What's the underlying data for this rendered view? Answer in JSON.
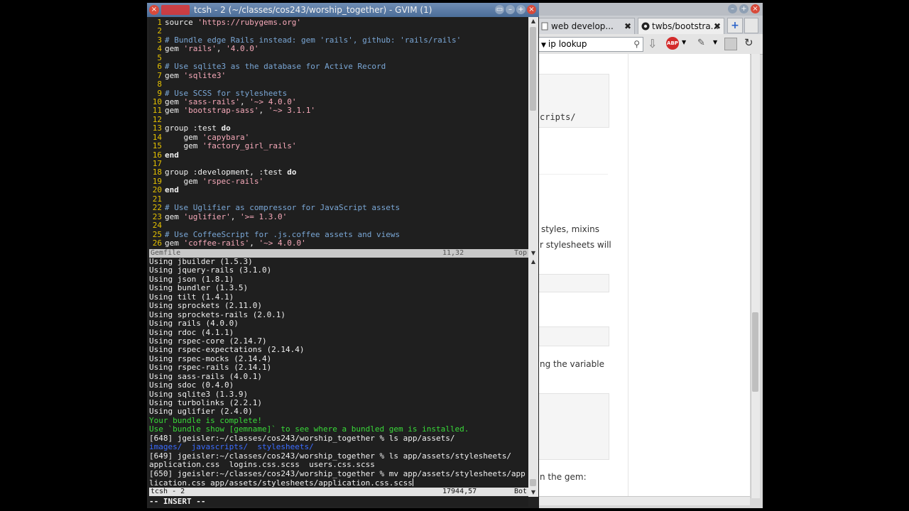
{
  "browser": {
    "tabs": [
      {
        "label": "web develop...",
        "close": "✖"
      },
      {
        "label": "twbs/bootstra...",
        "close": "✖"
      }
    ],
    "search": {
      "value": "ip lookup"
    },
    "page_fragments": [
      "cripts/",
      "styles, mixins",
      "r stylesheets will",
      "ng the variable",
      "n the gem:"
    ]
  },
  "gvim": {
    "title": "tcsh - 2 (~/classes/cos243/worship_together) - GVIM (1)",
    "editor_lines": [
      [
        {
          "t": "source ",
          "c": "tx"
        },
        {
          "t": "'https://rubygems.org'",
          "c": "str"
        }
      ],
      [],
      [
        {
          "t": "# Bundle edge Rails instead: gem 'rails', github: 'rails/rails'",
          "c": "cm"
        }
      ],
      [
        {
          "t": "gem ",
          "c": "tx"
        },
        {
          "t": "'rails'",
          "c": "str"
        },
        {
          "t": ", ",
          "c": "tx"
        },
        {
          "t": "'4.0.0'",
          "c": "str"
        }
      ],
      [],
      [
        {
          "t": "# Use sqlite3 as the database for Active Record",
          "c": "cm"
        }
      ],
      [
        {
          "t": "gem ",
          "c": "tx"
        },
        {
          "t": "'sqlite3'",
          "c": "str"
        }
      ],
      [],
      [
        {
          "t": "# Use SCSS for stylesheets",
          "c": "cm"
        }
      ],
      [
        {
          "t": "gem ",
          "c": "tx"
        },
        {
          "t": "'sass-rails'",
          "c": "str"
        },
        {
          "t": ", ",
          "c": "tx"
        },
        {
          "t": "'~> 4.0.0'",
          "c": "str"
        }
      ],
      [
        {
          "t": "gem ",
          "c": "tx"
        },
        {
          "t": "'bootstrap-sass'",
          "c": "str"
        },
        {
          "t": ", ",
          "c": "tx"
        },
        {
          "t": "'~> 3.1.1'",
          "c": "str"
        }
      ],
      [],
      [
        {
          "t": "group ",
          "c": "tx"
        },
        {
          "t": ":test ",
          "c": "sym"
        },
        {
          "t": "do",
          "c": "kw"
        }
      ],
      [
        {
          "t": "    gem ",
          "c": "tx"
        },
        {
          "t": "'capybara'",
          "c": "str"
        }
      ],
      [
        {
          "t": "    gem ",
          "c": "tx"
        },
        {
          "t": "'factory_girl_rails'",
          "c": "str"
        }
      ],
      [
        {
          "t": "end",
          "c": "kw"
        }
      ],
      [],
      [
        {
          "t": "group ",
          "c": "tx"
        },
        {
          "t": ":development",
          "c": "sym"
        },
        {
          "t": ", ",
          "c": "tx"
        },
        {
          "t": ":test ",
          "c": "sym"
        },
        {
          "t": "do",
          "c": "kw"
        }
      ],
      [
        {
          "t": "    gem ",
          "c": "tx"
        },
        {
          "t": "'rspec-rails'",
          "c": "str"
        }
      ],
      [
        {
          "t": "end",
          "c": "kw"
        }
      ],
      [],
      [
        {
          "t": "# Use Uglifier as compressor for JavaScript assets",
          "c": "cm"
        }
      ],
      [
        {
          "t": "gem ",
          "c": "tx"
        },
        {
          "t": "'uglifier'",
          "c": "str"
        },
        {
          "t": ", ",
          "c": "tx"
        },
        {
          "t": "'>= 1.3.0'",
          "c": "str"
        }
      ],
      [],
      [
        {
          "t": "# Use CoffeeScript for .js.coffee assets and views",
          "c": "cm"
        }
      ],
      [
        {
          "t": "gem ",
          "c": "tx"
        },
        {
          "t": "'coffee-rails'",
          "c": "str"
        },
        {
          "t": ", ",
          "c": "tx"
        },
        {
          "t": "'~> 4.0.0'",
          "c": "str"
        }
      ]
    ],
    "status_top": {
      "file": "Gemfile",
      "pos": "11,32",
      "scroll": "Top"
    },
    "terminal_lines": [
      [
        {
          "t": "Using jbuilder (1.5.3)",
          "c": "tw"
        }
      ],
      [
        {
          "t": "Using jquery-rails (3.1.0)",
          "c": "tw"
        }
      ],
      [
        {
          "t": "Using json (1.8.1)",
          "c": "tw"
        }
      ],
      [
        {
          "t": "Using bundler (1.3.5)",
          "c": "tw"
        }
      ],
      [
        {
          "t": "Using tilt (1.4.1)",
          "c": "tw"
        }
      ],
      [
        {
          "t": "Using sprockets (2.11.0)",
          "c": "tw"
        }
      ],
      [
        {
          "t": "Using sprockets-rails (2.0.1)",
          "c": "tw"
        }
      ],
      [
        {
          "t": "Using rails (4.0.0)",
          "c": "tw"
        }
      ],
      [
        {
          "t": "Using rdoc (4.1.1)",
          "c": "tw"
        }
      ],
      [
        {
          "t": "Using rspec-core (2.14.7)",
          "c": "tw"
        }
      ],
      [
        {
          "t": "Using rspec-expectations (2.14.4)",
          "c": "tw"
        }
      ],
      [
        {
          "t": "Using rspec-mocks (2.14.4)",
          "c": "tw"
        }
      ],
      [
        {
          "t": "Using rspec-rails (2.14.1)",
          "c": "tw"
        }
      ],
      [
        {
          "t": "Using sass-rails (4.0.1)",
          "c": "tw"
        }
      ],
      [
        {
          "t": "Using sdoc (0.4.0)",
          "c": "tw"
        }
      ],
      [
        {
          "t": "Using sqlite3 (1.3.9)",
          "c": "tw"
        }
      ],
      [
        {
          "t": "Using turbolinks (2.2.1)",
          "c": "tw"
        }
      ],
      [
        {
          "t": "Using uglifier (2.4.0)",
          "c": "tw"
        }
      ],
      [
        {
          "t": "Your bundle is complete!",
          "c": "tg"
        }
      ],
      [
        {
          "t": "Use `bundle show [gemname]` to see where a bundled gem is installed.",
          "c": "tg"
        }
      ],
      [
        {
          "t": "[648] jgeisler:~/classes/cos243/worship_together % ls app/assets/",
          "c": "tw"
        }
      ],
      [
        {
          "t": "images/  javascripts/  stylesheets/",
          "c": "tb"
        }
      ],
      [
        {
          "t": "[649] jgeisler:~/classes/cos243/worship_together % ls app/assets/stylesheets/",
          "c": "tw"
        }
      ],
      [
        {
          "t": "application.css  logins.css.scss  users.css.scss",
          "c": "tw"
        }
      ],
      [
        {
          "t": "[650] jgeisler:~/classes/cos243/worship_together % mv app/assets/stylesheets/app",
          "c": "tw"
        }
      ],
      [
        {
          "t": "lication.css app/assets/stylesheets/application.css.scss",
          "c": "tw"
        }
      ]
    ],
    "status_bottom": {
      "file": "tcsh - 2",
      "pos": "17944,57",
      "scroll": "Bot"
    },
    "mode": "-- INSERT --"
  }
}
